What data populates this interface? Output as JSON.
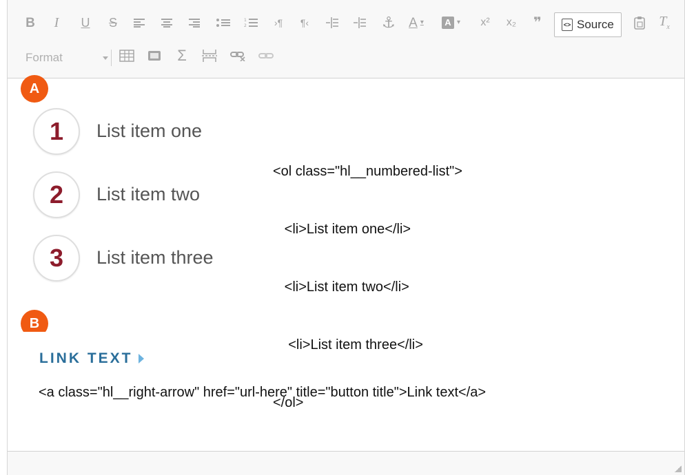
{
  "toolbar": {
    "row1": [
      {
        "name": "bold-button",
        "glyph": "B"
      },
      {
        "name": "italic-button",
        "glyph": "I"
      },
      {
        "name": "underline-button",
        "glyph": "U"
      },
      {
        "name": "strikethrough-button",
        "glyph": "S"
      },
      {
        "name": "align-left-button",
        "glyph": "≡"
      },
      {
        "name": "align-center-button",
        "glyph": "≡"
      },
      {
        "name": "align-right-button",
        "glyph": "≡"
      },
      {
        "name": "bulleted-list-button",
        "glyph": "⁝≡"
      },
      {
        "name": "numbered-list-button",
        "glyph": "⋮≡"
      },
      {
        "name": "ltr-button",
        "glyph": "›¶"
      },
      {
        "name": "rtl-button",
        "glyph": "¶‹"
      },
      {
        "name": "decrease-indent-button",
        "glyph": "⇤"
      },
      {
        "name": "increase-indent-button",
        "glyph": "⇥"
      },
      {
        "name": "anchor-button",
        "glyph": "⚓"
      },
      {
        "name": "text-color-button",
        "glyph": "A"
      },
      {
        "name": "bg-color-button",
        "glyph": "A"
      },
      {
        "name": "superscript-button",
        "glyph": "x²"
      },
      {
        "name": "subscript-button",
        "glyph": "x₂"
      },
      {
        "name": "blockquote-button",
        "glyph": "❞"
      }
    ],
    "source_label": "Source",
    "format_label": "Format"
  },
  "content": {
    "section_a_badge": "A",
    "section_b_badge": "B",
    "numbered_list": [
      {
        "number": "1",
        "label": "List item one"
      },
      {
        "number": "2",
        "label": "List item two"
      },
      {
        "number": "3",
        "label": "List item three"
      }
    ],
    "code_lines": [
      "<ol class=\"hl__numbered-list\">",
      "   <li>List item one</li>",
      "   <li>List item two</li>",
      "    <li>List item three</li>",
      "</ol>"
    ],
    "link_text": "LINK TEXT",
    "link_code": "<a class=\"hl__right-arrow\" href=\"url-here\" title=\"button title\">Link text</a>"
  },
  "colors": {
    "badge": "#f05a12",
    "number": "#8d1c2c",
    "link": "#2a6e9a",
    "toolbar_icon": "#a5a5a5"
  }
}
